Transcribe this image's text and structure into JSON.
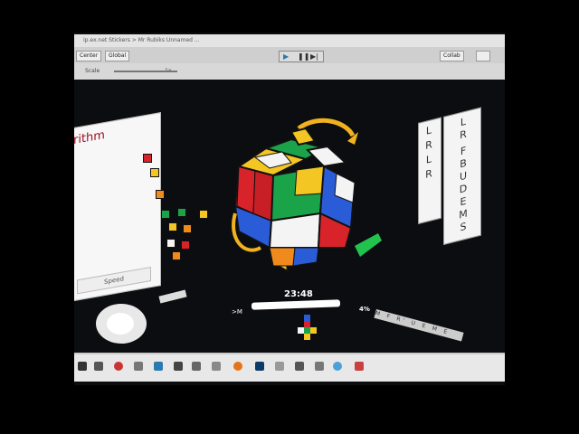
{
  "editor": {
    "menu_text": "ip.ex.net       Stickers  >  Mr Rubiks  Unnamed  ...",
    "menu_text2": "File  Edit  Assets  GameObject  Component  Window  Help",
    "center_label": "Center",
    "global_label": "Global",
    "collab_label": "Collab",
    "scale_label": "Scale",
    "scale_value": "1x"
  },
  "panels": {
    "algorithm_title": "rithm",
    "speed_label": "Speed"
  },
  "moves_panel": {
    "letters_col1": [
      "L",
      "R",
      "L",
      "R"
    ],
    "letters_col2": [
      "L",
      "R",
      "F",
      "B",
      "U",
      "D",
      "E",
      "M",
      "S"
    ]
  },
  "hud": {
    "time": "23:48",
    "percent": "4%",
    "arrow_label": ">M",
    "progress": 0.9,
    "moves_strip": "M F R' U E M E"
  },
  "colors": {
    "cube_red": "#d8232a",
    "cube_green": "#1ba34a",
    "cube_blue": "#2a5cd8",
    "cube_yellow": "#f3c623",
    "cube_orange": "#f08a1c",
    "cube_white": "#f4f4f4",
    "arrow_yellow": "#f1b21f",
    "arrow_green": "#22c24e"
  },
  "taskbar": {
    "icons": [
      "windows-icon",
      "search-icon",
      "chrome-icon",
      "files-icon",
      "edge-icon",
      "unity-icon",
      "explorer-icon",
      "settings-icon",
      "firefox-icon",
      "photoshop-icon",
      "app-icon",
      "network-icon",
      "volume-icon",
      "cloud-icon",
      "store-icon",
      "power-icon"
    ]
  }
}
